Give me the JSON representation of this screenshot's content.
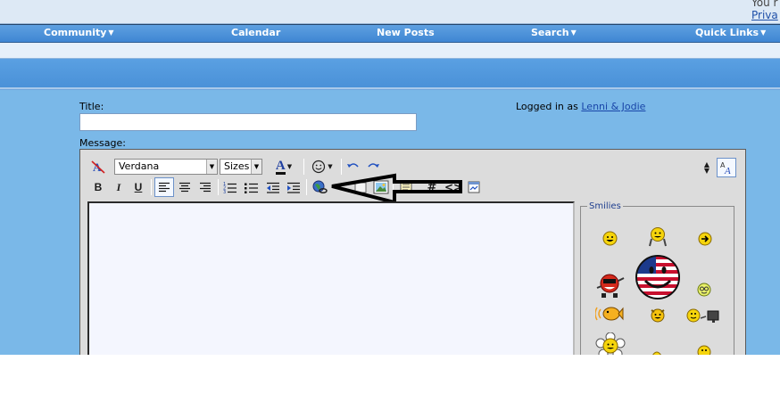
{
  "header": {
    "corner_top_text": "You r",
    "corner_link_text": "Priva"
  },
  "navbar": {
    "items": [
      {
        "label": "Community",
        "has_menu": true
      },
      {
        "label": "Calendar",
        "has_menu": false
      },
      {
        "label": "New Posts",
        "has_menu": false
      },
      {
        "label": "Search",
        "has_menu": true
      },
      {
        "label": "Quick Links",
        "has_menu": true
      }
    ]
  },
  "form": {
    "title_label": "Title:",
    "title_value": "",
    "message_label": "Message:",
    "logged_in_prefix": "Logged in as",
    "logged_in_user": "Lenni & Jodie"
  },
  "toolbar": {
    "font_name": "Verdana",
    "font_size": "Sizes",
    "bold_label": "B",
    "italic_label": "I",
    "underline_label": "U",
    "font_color_glyph": "A",
    "code_glyph": "#",
    "html_glyph": "<>"
  },
  "editor": {
    "message_value": ""
  },
  "smilies": {
    "legend": "Smilies",
    "items": [
      "smile-icon",
      "cheer-icon",
      "arrow-smiley-icon",
      "pirate-icon",
      "usa-flag-smiley-icon",
      "wink-icon",
      "fish-icon",
      "devil-icon",
      "tv-smiley-icon",
      "flower-smiley-icon",
      "partial-smiley-icon",
      "partial-smiley-icon-2"
    ]
  },
  "colors": {
    "page_blue": "#7ab8e8",
    "nav_blue": "#4a90d9",
    "editor_gray": "#dcdcdc",
    "link_blue": "#1845a8"
  }
}
